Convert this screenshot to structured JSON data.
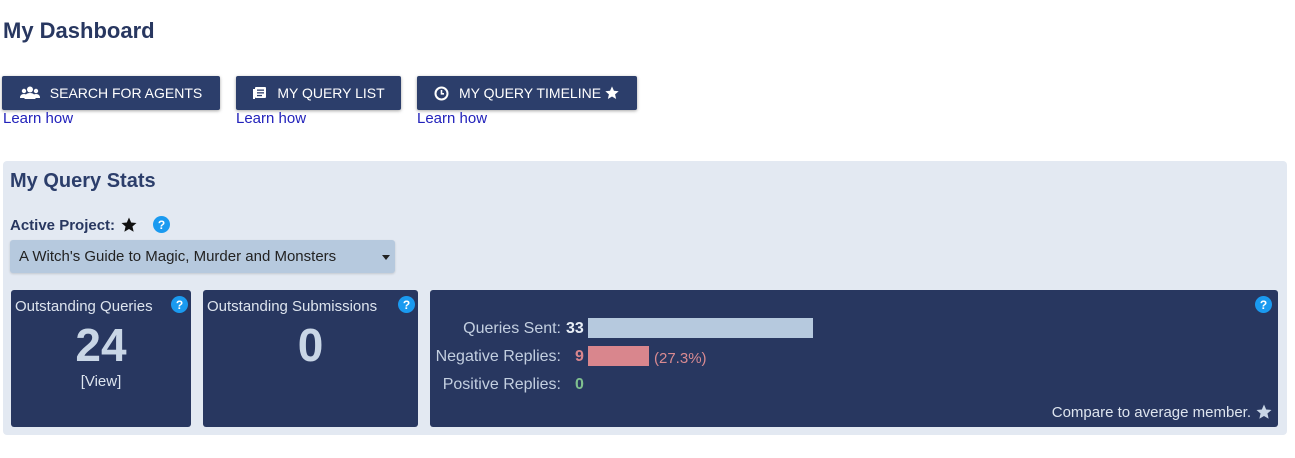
{
  "page_title": "My Dashboard",
  "buttons": [
    {
      "label": "SEARCH FOR AGENTS",
      "icon": "users-icon",
      "learn": "Learn how"
    },
    {
      "label": "MY QUERY LIST",
      "icon": "list-icon",
      "learn": "Learn how"
    },
    {
      "label": "MY QUERY TIMELINE",
      "icon": "clock-icon",
      "learn": "Learn how",
      "badge": "star-icon"
    }
  ],
  "stats": {
    "title": "My Query Stats",
    "active_project_label": "Active Project:",
    "active_project_value": "A Witch's Guide to Magic, Murder and Monsters",
    "help_glyph": "?",
    "outstanding_queries": {
      "label": "Outstanding Queries",
      "value": "24",
      "link": "[View]"
    },
    "outstanding_submissions": {
      "label": "Outstanding Submissions",
      "value": "0"
    },
    "summary": {
      "queries_sent_label": "Queries Sent:",
      "queries_sent": 33,
      "negative_label": "Negative Replies:",
      "negative": 9,
      "negative_pct": "(27.3%)",
      "positive_label": "Positive Replies:",
      "positive": 0,
      "compare": "Compare to average member."
    },
    "colors": {
      "sent_bar": "#b6c9de",
      "negative": "#d9868d",
      "positive": "#7fbf8f",
      "card_bg": "#283760"
    }
  }
}
